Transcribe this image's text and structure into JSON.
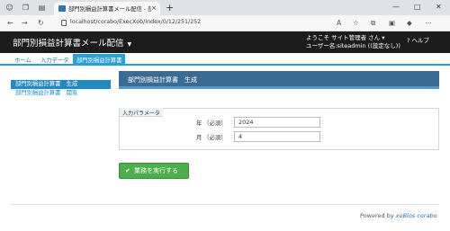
{
  "browser": {
    "tab_title": "部門別損益計算書メール配信 - 部門別",
    "url": "localhost/corabo/ExecXob/Index/0/12/251/252",
    "tab_close": "×",
    "new_tab": "+",
    "win_min": "—",
    "win_max": "□",
    "win_close": "✕",
    "icons": [
      "back-icon",
      "forward-icon",
      "refresh-icon",
      "lock-icon",
      "read-aloud-icon",
      "favorite-icon",
      "extensions-icon",
      "profile-icon",
      "more-icon"
    ]
  },
  "header": {
    "title": "部門別損益計算書メール配信",
    "caret": "▼",
    "welcome": "ようこそ サイト管理者 さん",
    "welcome_caret": "▾",
    "username": "ユーザー名:siteadmin ((設定なし))",
    "help": "? ヘルプ"
  },
  "tabs": [
    {
      "label": "ホーム"
    },
    {
      "label": "入力データ"
    },
    {
      "label": "部門別損益計算書"
    }
  ],
  "sidebar": {
    "items": [
      {
        "label": "部門別損益計算書　生成"
      },
      {
        "label": "部門別損益計算書　閲覧"
      }
    ]
  },
  "main": {
    "panel_title": "部門別損益計算書　生成",
    "params_label": "入力パラメータ",
    "year_label": "年 （必須）",
    "year_value": "2024",
    "month_label": "月 （必須）",
    "month_value": "4",
    "run_button": "業務を実行する",
    "run_icon": "✔"
  },
  "footer": {
    "powered": "Powered by",
    "brand": "xoBlos corabo"
  },
  "colors": {
    "accent": "#2aa0d4",
    "header_bg": "#1c1c1c",
    "panel_head": "#3a6b94",
    "run_button": "#4cae4c"
  }
}
